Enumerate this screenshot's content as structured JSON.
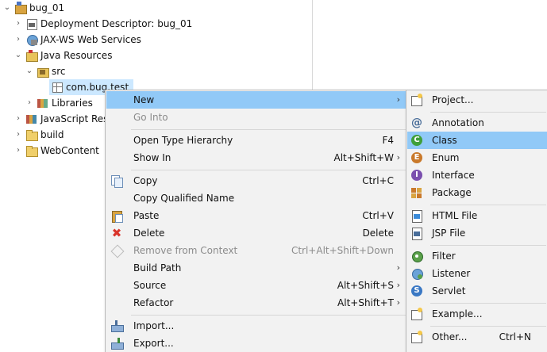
{
  "tree": {
    "items": [
      {
        "label": "bug_01",
        "icon": "project-icon",
        "twisty": "expanded"
      },
      {
        "label": "Deployment Descriptor: bug_01",
        "icon": "deployment-descriptor-icon",
        "twisty": "collapsed"
      },
      {
        "label": "JAX-WS Web Services",
        "icon": "web-services-icon",
        "twisty": "collapsed"
      },
      {
        "label": "Java Resources",
        "icon": "java-resources-icon",
        "twisty": "expanded"
      },
      {
        "label": "src",
        "icon": "source-folder-icon",
        "twisty": "expanded"
      },
      {
        "label": "com.bug.test",
        "icon": "package-icon",
        "twisty": "none"
      },
      {
        "label": "Libraries",
        "icon": "libraries-icon",
        "twisty": "collapsed"
      },
      {
        "label": "JavaScript Res",
        "icon": "javascript-resources-icon",
        "twisty": "collapsed"
      },
      {
        "label": "build",
        "icon": "folder-icon",
        "twisty": "collapsed"
      },
      {
        "label": "WebContent",
        "icon": "folder-icon",
        "twisty": "collapsed"
      }
    ]
  },
  "context_menu": {
    "items": [
      {
        "label": "New",
        "shortcut": "",
        "submenu": true,
        "highlighted": true,
        "icon": ""
      },
      {
        "label": "Go Into",
        "shortcut": "",
        "disabled": true
      },
      {
        "label": "Open Type Hierarchy",
        "shortcut": "F4"
      },
      {
        "label": "Show In",
        "shortcut": "Alt+Shift+W",
        "submenu": true
      },
      {
        "label": "Copy",
        "shortcut": "Ctrl+C",
        "icon": "copy-icon"
      },
      {
        "label": "Copy Qualified Name",
        "shortcut": ""
      },
      {
        "label": "Paste",
        "shortcut": "Ctrl+V",
        "icon": "paste-icon"
      },
      {
        "label": "Delete",
        "shortcut": "Delete",
        "icon": "delete-icon"
      },
      {
        "label": "Remove from Context",
        "shortcut": "Ctrl+Alt+Shift+Down",
        "disabled": true,
        "icon": "remove-context-icon"
      },
      {
        "label": "Build Path",
        "shortcut": "",
        "submenu": true
      },
      {
        "label": "Source",
        "shortcut": "Alt+Shift+S",
        "submenu": true
      },
      {
        "label": "Refactor",
        "shortcut": "Alt+Shift+T",
        "submenu": true
      },
      {
        "label": "Import...",
        "shortcut": "",
        "icon": "import-icon"
      },
      {
        "label": "Export...",
        "shortcut": "",
        "icon": "export-icon"
      }
    ]
  },
  "new_submenu": {
    "items": [
      {
        "label": "Project...",
        "icon": "new-project-icon"
      },
      {
        "label": "Annotation",
        "icon": "annotation-icon"
      },
      {
        "label": "Class",
        "icon": "class-icon",
        "highlighted": true
      },
      {
        "label": "Enum",
        "icon": "enum-icon"
      },
      {
        "label": "Interface",
        "icon": "interface-icon"
      },
      {
        "label": "Package",
        "icon": "package-icon"
      },
      {
        "label": "HTML File",
        "icon": "html-file-icon"
      },
      {
        "label": "JSP File",
        "icon": "jsp-file-icon"
      },
      {
        "label": "Filter",
        "icon": "filter-icon"
      },
      {
        "label": "Listener",
        "icon": "listener-icon"
      },
      {
        "label": "Servlet",
        "icon": "servlet-icon"
      },
      {
        "label": "Example...",
        "icon": "example-icon"
      },
      {
        "label": "Other...",
        "shortcut": "Ctrl+N",
        "icon": "other-icon"
      }
    ]
  },
  "colors": {
    "highlight": "#91c9f7",
    "tree_selected": "#cce8ff",
    "menu_bg": "#f2f2f2",
    "class_icon": "#3f9f3a",
    "enum_icon": "#c9792b",
    "interface_icon": "#7a4fae",
    "delete_icon": "#d9342b"
  }
}
